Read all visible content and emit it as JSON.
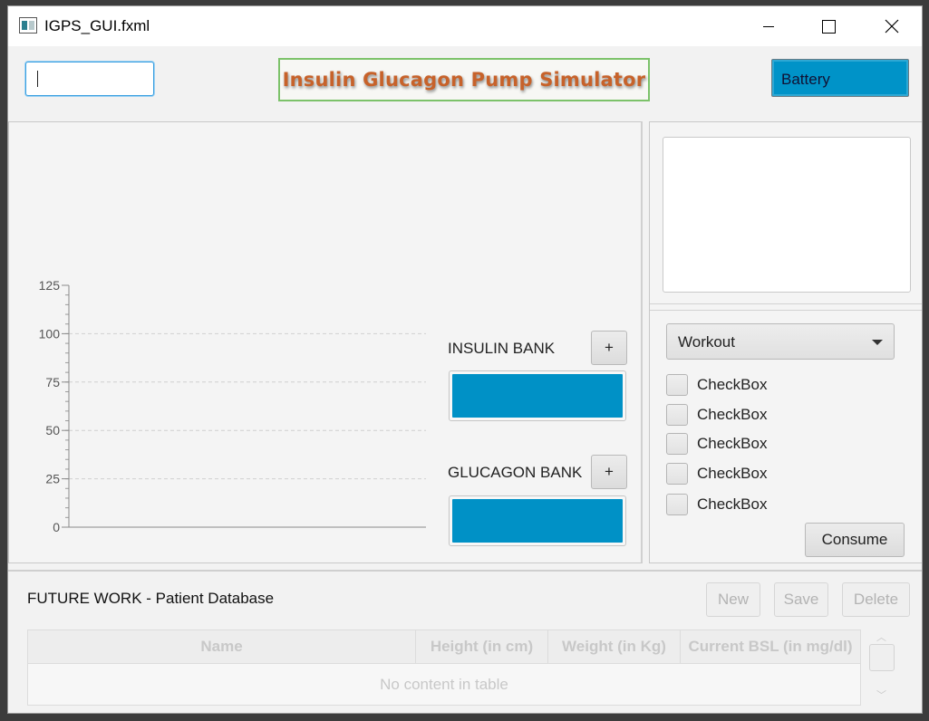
{
  "window": {
    "title": "IGPS_GUI.fxml"
  },
  "header": {
    "search_value": "",
    "banner_text": "Insulin Glucagon Pump Simulator",
    "battery_label": "Battery"
  },
  "chart_data": {
    "type": "line",
    "title": "",
    "xlabel": "",
    "ylabel": "",
    "ylim": [
      0,
      125
    ],
    "yticks": [
      0,
      25,
      50,
      75,
      100,
      125
    ],
    "series": [],
    "grid": "horizontal dashed"
  },
  "banks": {
    "insulin": {
      "label": "INSULIN BANK",
      "add_label": "+",
      "level": 1.0
    },
    "glucagon": {
      "label": "GLUCAGON BANK",
      "add_label": "+",
      "level": 1.0
    }
  },
  "side": {
    "notes_value": "",
    "activity_select": {
      "selected": "Workout"
    },
    "checkboxes": [
      {
        "label": "CheckBox",
        "checked": false
      },
      {
        "label": "CheckBox",
        "checked": false
      },
      {
        "label": "CheckBox",
        "checked": false
      },
      {
        "label": "CheckBox",
        "checked": false
      },
      {
        "label": "CheckBox",
        "checked": false
      }
    ],
    "consume_label": "Consume"
  },
  "database": {
    "title": "FUTURE WORK - Patient Database",
    "buttons": {
      "new": "New",
      "save": "Save",
      "delete": "Delete"
    },
    "columns": [
      "Name",
      "Height (in cm)",
      "Weight (in Kg)",
      "Current BSL (in mg/dl)"
    ],
    "empty_message": "No content in table"
  },
  "colors": {
    "accent_blue": "#0093c8",
    "banner_text": "#c7622a",
    "banner_border": "#7cc26a"
  }
}
